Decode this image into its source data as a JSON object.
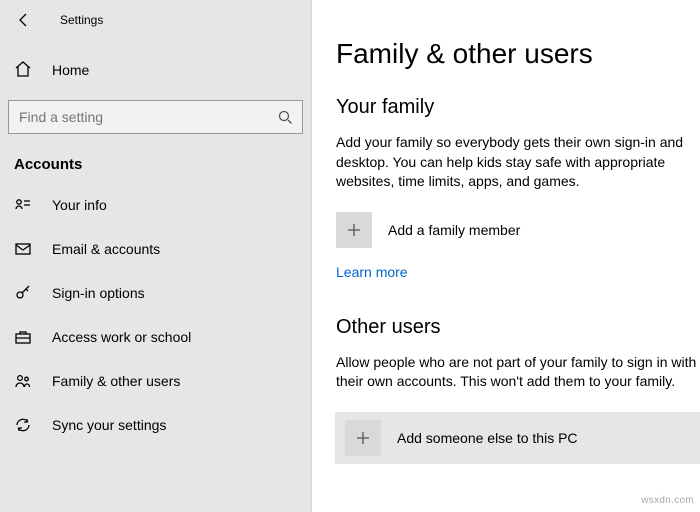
{
  "app": {
    "title": "Settings"
  },
  "sidebar": {
    "home": "Home",
    "search_placeholder": "Find a setting",
    "section": "Accounts",
    "items": [
      {
        "label": "Your info"
      },
      {
        "label": "Email & accounts"
      },
      {
        "label": "Sign-in options"
      },
      {
        "label": "Access work or school"
      },
      {
        "label": "Family & other users"
      },
      {
        "label": "Sync your settings"
      }
    ]
  },
  "main": {
    "title": "Family & other users",
    "family": {
      "heading": "Your family",
      "body": "Add your family so everybody gets their own sign-in and desktop. You can help kids stay safe with appropriate websites, time limits, apps, and games.",
      "add_label": "Add a family member",
      "learn_more": "Learn more"
    },
    "other": {
      "heading": "Other users",
      "body": "Allow people who are not part of your family to sign in with their own accounts. This won't add them to your family.",
      "add_label": "Add someone else to this PC"
    }
  },
  "watermark": "wsxdn.com"
}
